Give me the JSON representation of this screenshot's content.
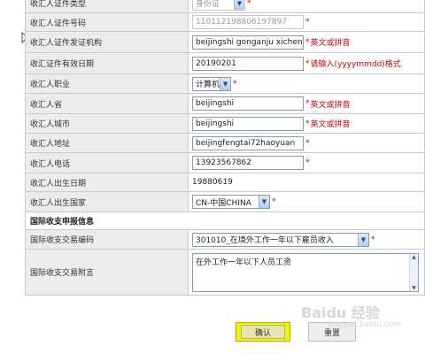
{
  "form": {
    "rows": [
      {
        "label": "收汇人证件类型",
        "select": "身份证",
        "disabled": true,
        "star": "*"
      },
      {
        "label": "收汇人证件号码",
        "input": "110112198806197897",
        "disabled": true,
        "star": "*"
      },
      {
        "label": "收汇人证件发证机构",
        "input": "beijingshi gonganju xichen",
        "star": "*",
        "hint": "英文或拼音"
      },
      {
        "label": "收汇证件有效日期",
        "input": "20190201",
        "star": "*",
        "hint": "请输入(yyyymmdd)格式"
      },
      {
        "label": "收汇人职业",
        "select": "计算机",
        "star": "*"
      },
      {
        "label": "收汇人省",
        "input": "beijingshi",
        "star": "*",
        "hint": "英文或拼音"
      },
      {
        "label": "收汇人城市",
        "input": "beijingshi",
        "star": "*",
        "hint": "英文或拼音"
      },
      {
        "label": "收汇人地址",
        "input": "beijingfengtai72haoyuan",
        "star": "*"
      },
      {
        "label": "收汇人电话",
        "input": "13923567862",
        "star": "*"
      },
      {
        "label": "收汇人出生日期",
        "text": "19880619"
      },
      {
        "label": "收汇人出生国家",
        "select": "CN-中国CHINA",
        "star": "*"
      }
    ],
    "section_title": "国际收支申报信息",
    "trade_code": {
      "label": "国际收支交易编码",
      "select": "301010_在境外工作一年以下雇员收入",
      "star": "*"
    },
    "trade_note": {
      "label": "国际收支交易附言",
      "value": "在外工作一年以下人员工资"
    }
  },
  "buttons": {
    "confirm": "确认",
    "reset": "重置"
  },
  "watermark": {
    "brand": "Baidu 经验",
    "url": "jingyan.baidu.com"
  }
}
